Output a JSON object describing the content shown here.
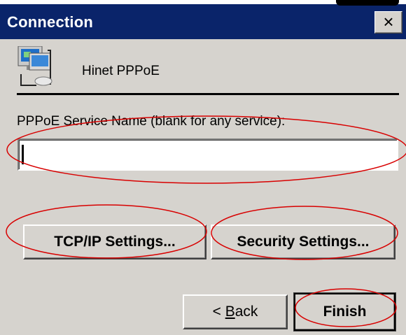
{
  "window": {
    "title": "Connection",
    "close_glyph": "×"
  },
  "connection": {
    "icon": "network-connection-icon",
    "name": "Hinet PPPoE"
  },
  "service_field": {
    "label": "PPPoE Service Name (blank for any service):",
    "value": ""
  },
  "buttons": {
    "tcpip": "TCP/IP Settings...",
    "security": "Security Settings...",
    "back_prefix": "< ",
    "back_mnemonic": "B",
    "back_rest": "ack",
    "finish": "Finish"
  },
  "colors": {
    "titlebar": "#0a246a",
    "dialog_bg": "#d6d3ce",
    "annotation": "#d80000"
  }
}
